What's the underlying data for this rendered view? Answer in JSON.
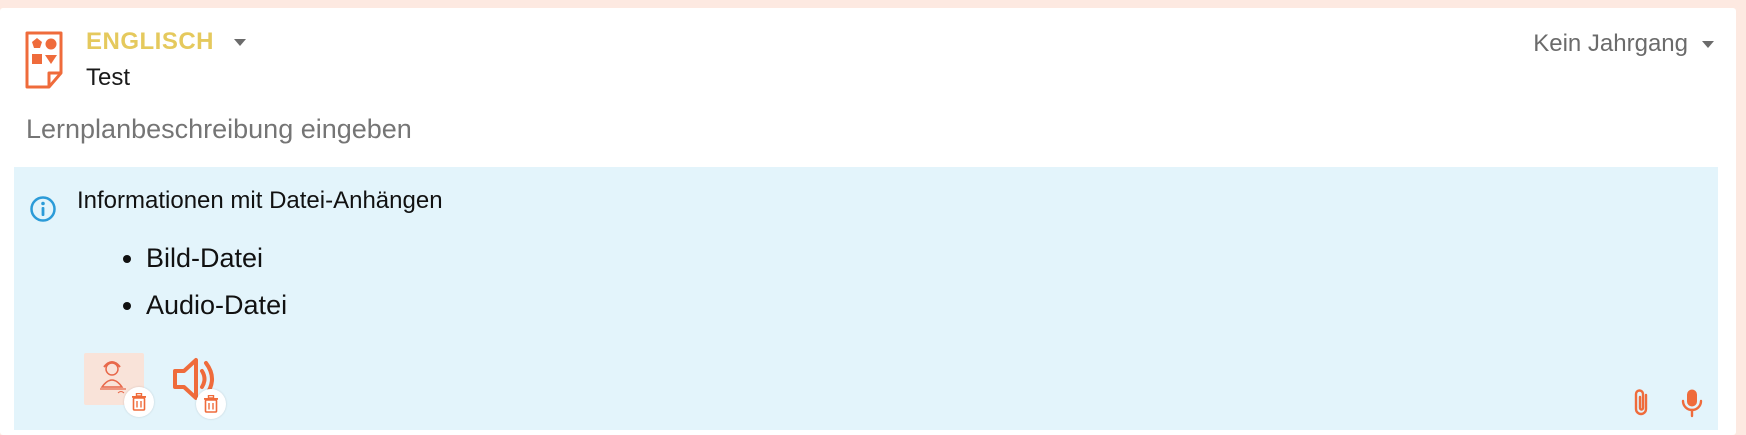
{
  "header": {
    "subject": "ENGLISCH",
    "title": "Test",
    "year_label": "Kein Jahrgang"
  },
  "description": {
    "placeholder": "Lernplanbeschreibung eingeben"
  },
  "info": {
    "title": "Informationen mit Datei-Anhängen",
    "items": [
      "Bild-Datei",
      "Audio-Datei"
    ]
  },
  "icons": {
    "document": "shapes-document-icon",
    "info": "info-circle-icon",
    "attachment": "paperclip-icon",
    "microphone": "microphone-icon",
    "audio": "speaker-icon",
    "delete": "trash-icon"
  },
  "colors": {
    "accent": "#ef6b3b",
    "subject": "#e5c95d",
    "info_background": "#e3f4fb",
    "info_icon": "#2b9bd8",
    "page_background": "#fde9e1"
  }
}
